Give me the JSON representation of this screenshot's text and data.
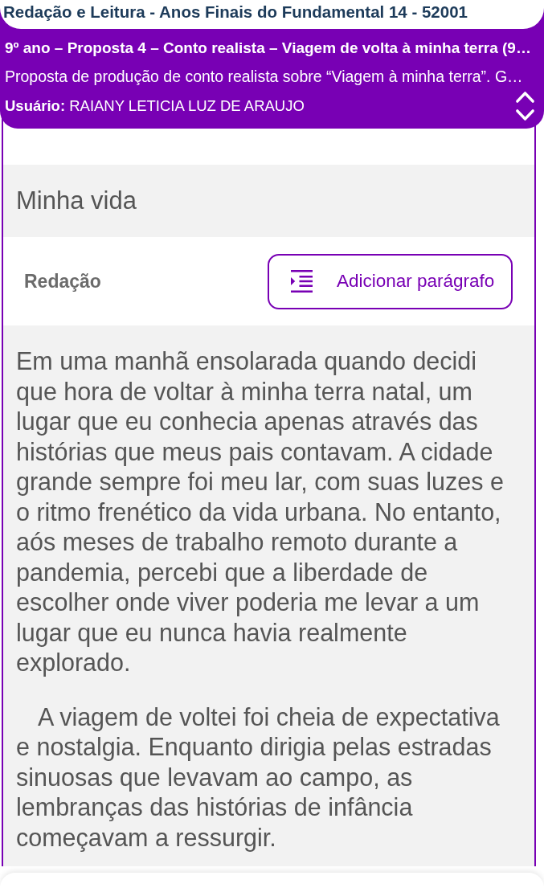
{
  "app_title": "Redação e Leitura - Anos Finais do Fundamental 14 - 52001",
  "assignment": {
    "title": "9º ano – Proposta 4 – Conto realista – Viagem de volta à minha terra (9…",
    "description": "Proposta de produção de conto realista sobre “Viagem à minha terra”. G…",
    "user": "**Usuário:** RAIANY LETICIA LUZ DE ARAUJO"
  },
  "essay": {
    "title": "Minha vida",
    "section_label": "Redação",
    "add_button": "Adicionar parágrafo",
    "paragraphs": [
      {
        "text": "Em uma manhã ensolarada quando decidi que hora de voltar à minha terra natal, um lugar que eu conhecia apenas através das histórias que meus pais contavam. A cidade grande sempre foi meu lar, com suas luzes e o ritmo frenético da vida urbana. No entanto, aós meses de trabalho remoto durante a pandemia, percebi que a liberdade de escolher onde viver poderia me levar a um lugar que eu nunca havia realmente explorado.",
        "indent": false
      },
      {
        "text": "A viagem de voltei foi cheia de expectativa e nostalgia. Enquanto dirigia pelas estradas sinuosas que levavam ao campo, as lembranças das histórias de infância começavam a ressurgir.",
        "indent": true
      }
    ]
  }
}
